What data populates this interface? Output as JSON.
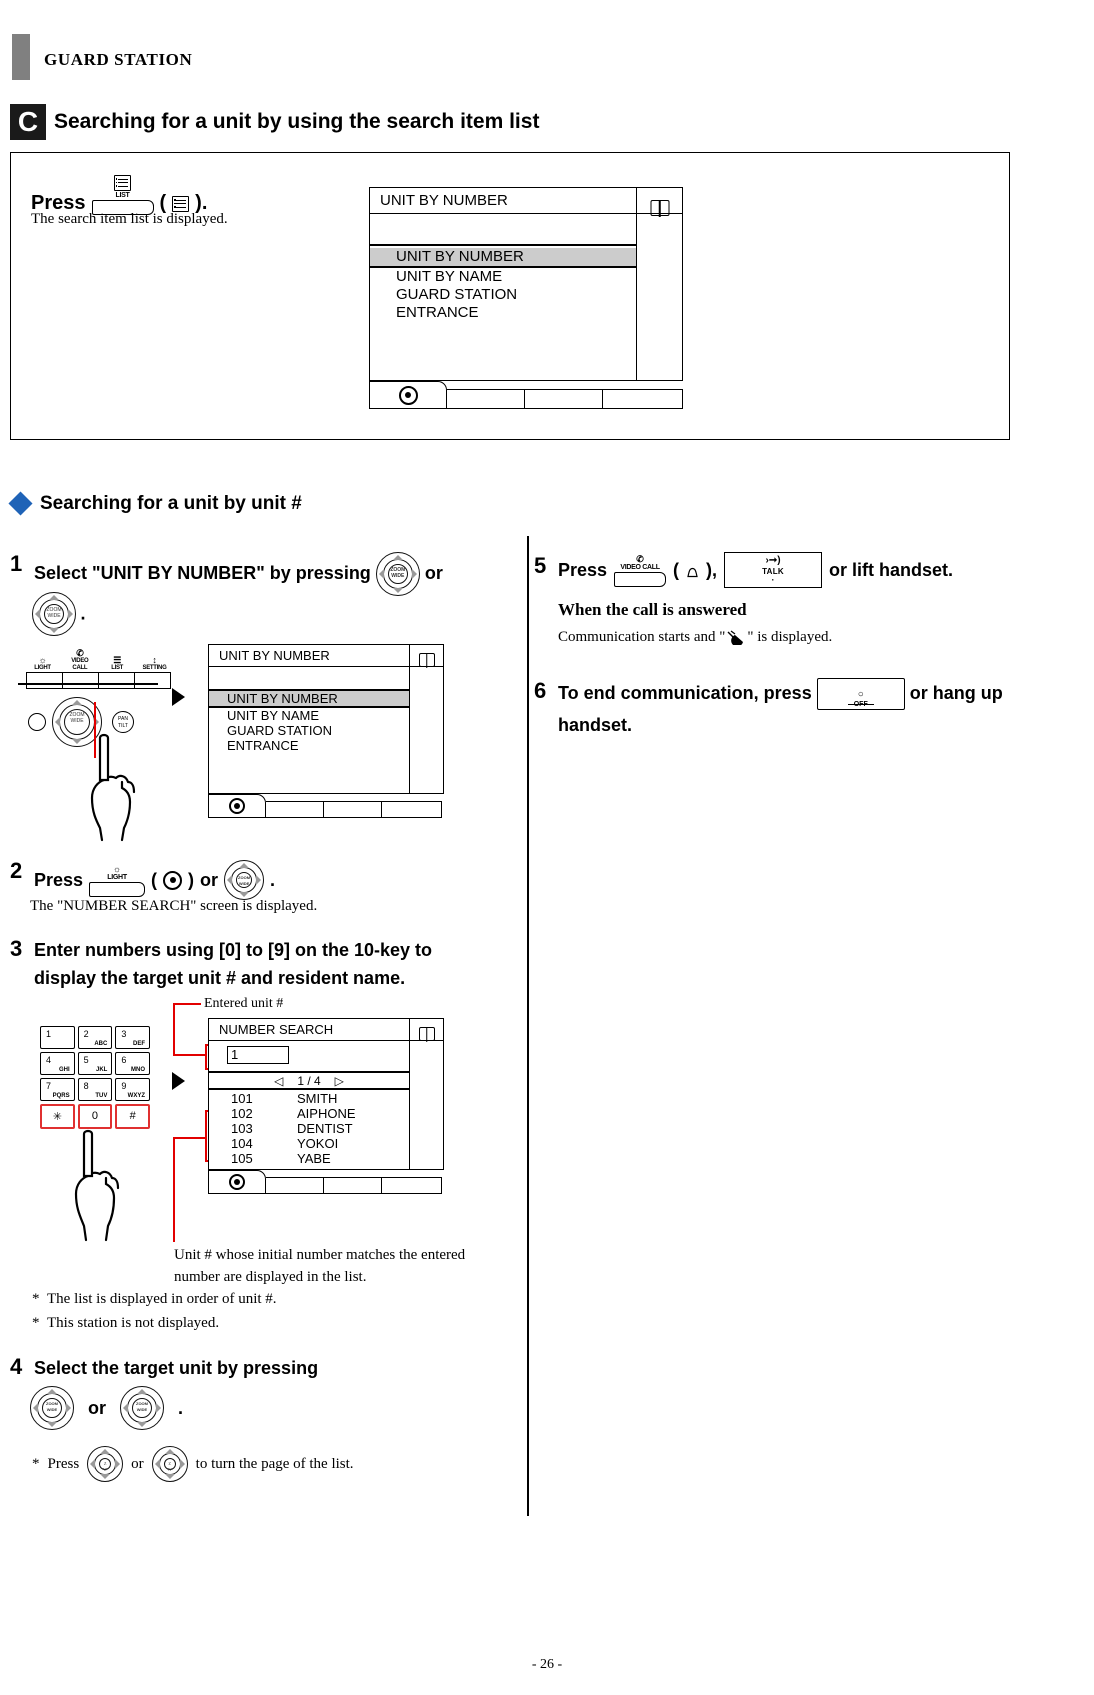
{
  "header": {
    "title": "GUARD STATION"
  },
  "section": {
    "badge": "C",
    "title": "Searching for a unit by using the search item list"
  },
  "topbox": {
    "press_word": "Press",
    "key": {
      "label": "LIST",
      "glyph": "list-icon"
    },
    "paren_open": "(",
    "paren_close": ").",
    "sub": "The search item list is displayed.",
    "lcd": {
      "title": "UNIT BY NUMBER",
      "items": [
        "UNIT BY NUMBER",
        "UNIT BY NAME",
        "GUARD STATION",
        "ENTRANCE"
      ],
      "selected_index": 0
    }
  },
  "subsection": {
    "title": "Searching for a unit by unit #"
  },
  "steps": {
    "s1": {
      "num": "1",
      "text": "Select \"UNIT BY NUMBER\" by pressing",
      "or": "or",
      "period": ".",
      "keypanel": [
        {
          "label": "LIGHT",
          "glyph": "sun-icon"
        },
        {
          "label": "VIDEO CALL",
          "glyph": "video-call-icon"
        },
        {
          "label": "LIST",
          "glyph": "list-icon"
        },
        {
          "label": "SETTING",
          "glyph": "setting-icon"
        }
      ],
      "lcd": {
        "title": "UNIT BY NUMBER",
        "items": [
          "UNIT BY NUMBER",
          "UNIT BY NAME",
          "GUARD STATION",
          "ENTRANCE"
        ],
        "selected_index": 0
      }
    },
    "s2": {
      "num": "2",
      "press": "Press",
      "key_label": "LIGHT",
      "paren_open": "(",
      "paren_close": ")",
      "or": "or",
      "period": ".",
      "sub": "The \"NUMBER SEARCH\" screen is displayed."
    },
    "s3": {
      "num": "3",
      "text": "Enter numbers using [0] to [9] on the 10-key to display the target unit # and resident name.",
      "callout_top": "Entered unit #",
      "callout_bottom": "Unit # whose initial number matches the entered number are displayed in the list.",
      "notes": [
        "The list is displayed in order of unit #.",
        "This station is not displayed."
      ],
      "keypad": [
        {
          "n": "1",
          "a": ""
        },
        {
          "n": "2",
          "a": "ABC"
        },
        {
          "n": "3",
          "a": "DEF"
        },
        {
          "n": "4",
          "a": "GHI"
        },
        {
          "n": "5",
          "a": "JKL"
        },
        {
          "n": "6",
          "a": "MNO"
        },
        {
          "n": "7",
          "a": "PQRS"
        },
        {
          "n": "8",
          "a": "TUV"
        },
        {
          "n": "9",
          "a": "WXYZ"
        },
        {
          "n": "✳",
          "a": ""
        },
        {
          "n": "0",
          "a": ""
        },
        {
          "n": "#",
          "a": ""
        }
      ],
      "lcd": {
        "title": "NUMBER SEARCH",
        "entry_value": "1",
        "page_indicator": "1 / 4",
        "prev_arrow": "◁",
        "next_arrow": "▷",
        "rows": [
          {
            "unit": "101",
            "name": "SMITH"
          },
          {
            "unit": "102",
            "name": "AIPHONE"
          },
          {
            "unit": "103",
            "name": "DENTIST"
          },
          {
            "unit": "104",
            "name": "YOKOI"
          },
          {
            "unit": "105",
            "name": "YABE"
          }
        ]
      }
    },
    "s4": {
      "num": "4",
      "text": "Select the target unit by pressing",
      "or": "or",
      "period": ".",
      "note_press": "Press",
      "note_or": "or",
      "note_tail": "to turn the page of the list."
    },
    "s5": {
      "num": "5",
      "press": "Press",
      "key_label": "VIDEO CALL",
      "paren_open": "(",
      "paren_close": "),",
      "talk_button": {
        "top_glyph": "talk-ring-icon",
        "label": "TALK"
      },
      "tail": "or lift handset.",
      "answered_head": "When the call is answered",
      "answered_body_pre": "Communication starts and \"",
      "answered_body_post": "\" is displayed."
    },
    "s6": {
      "num": "6",
      "text_pre": "To end communication, press",
      "off_button": {
        "glyph": "off-ring-icon",
        "label": "OFF"
      },
      "text_post": "or hang up handset."
    }
  },
  "footer": "- 26 -",
  "colors": {
    "diamond": "#1f63b7",
    "callout": "#e20000",
    "selection": "#cccccc",
    "header_bar": "#808080"
  }
}
